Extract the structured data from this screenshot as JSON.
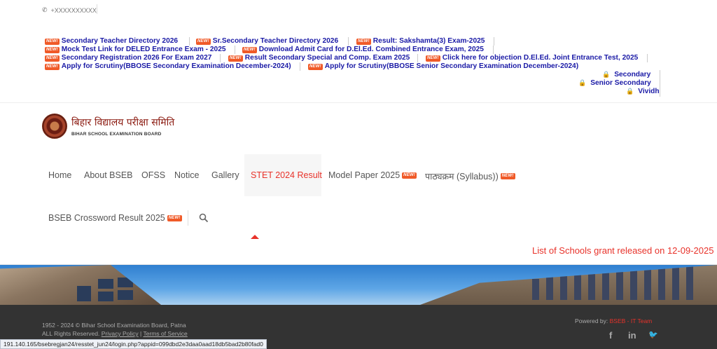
{
  "topbar": {
    "phone": "+XXXXXXXXXX",
    "phone_icon": "phone-icon"
  },
  "new_badge": "NEW!",
  "news": [
    "Secondary Teacher Directory 2026",
    "Sr.Secondary Teacher Directory 2026",
    "Result: Sakshamta(3) Exam-2025",
    "Mock Test Link for DELED Entrance Exam - 2025",
    "Download Admit Card for D.El.Ed. Combined Entrance Exam, 2025",
    "Secondary Registration 2026 For Exam 2027",
    "Result Secondary Special and Comp. Exam 2025",
    "Click here for objection D.El.Ed. Joint Entrance Test, 2025",
    "Apply for Scrutiny(BBOSE Secondary Examination December-2024)",
    "Apply for Scrutiny(BBOSE Senior Secondary Examination December-2024)"
  ],
  "locks": [
    "Secondary",
    "Senior Secondary",
    "Vividh"
  ],
  "logo": {
    "hindi": "बिहार विद्यालय परीक्षा समिति",
    "english": "BIHAR SCHOOL EXAMINATION BOARD"
  },
  "nav": [
    "Home",
    "About BSEB",
    "OFSS",
    "Notice",
    "Gallery",
    "STET 2024 Result",
    "Model Paper 2025",
    "पाठ्यक्रम (Syllabus))",
    "BSEB Crossword Result 2025"
  ],
  "marquee": "List of Schools grant released on 12-09-2025",
  "footer": {
    "copyright": "1952 - 2024 © Bihar School Examination Board, Patna",
    "rights": "ALL Rights Reserved.",
    "privacy": "Privacy Policy",
    "divider": "|",
    "terms": "Terms of Service",
    "powered_prefix": "Powered by:",
    "powered_team": "BSEB - IT Team",
    "social": [
      "f",
      "in",
      "🐦"
    ]
  },
  "status_url": "191.140.165/bsebregjan24/resstet_jun24/login.php?appid=099dbd2e3daa0aad18db5bad2b80fad0",
  "colors": {
    "link": "#1a1aa6",
    "accent": "#e8322a",
    "badge": "#f05a28",
    "footer_bg": "#333333"
  }
}
